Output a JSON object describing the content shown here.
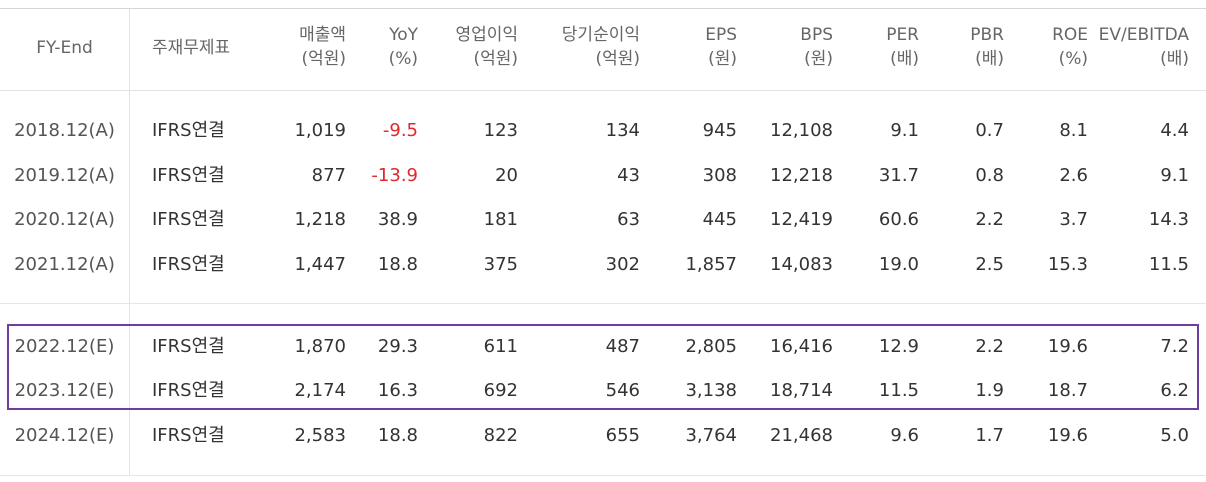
{
  "table": {
    "headers": [
      {
        "key": "fy",
        "line1": "FY-End",
        "line2": ""
      },
      {
        "key": "type",
        "line1": "주재무제표",
        "line2": ""
      },
      {
        "key": "sales",
        "line1": "매출액",
        "line2": "(억원)"
      },
      {
        "key": "yoy",
        "line1": "YoY",
        "line2": "(%)"
      },
      {
        "key": "op",
        "line1": "영업이익",
        "line2": "(억원)"
      },
      {
        "key": "net",
        "line1": "당기순이익",
        "line2": "(억원)"
      },
      {
        "key": "eps",
        "line1": "EPS",
        "line2": "(원)"
      },
      {
        "key": "bps",
        "line1": "BPS",
        "line2": "(원)"
      },
      {
        "key": "per",
        "line1": "PER",
        "line2": "(배)"
      },
      {
        "key": "pbr",
        "line1": "PBR",
        "line2": "(배)"
      },
      {
        "key": "roe",
        "line1": "ROE",
        "line2": "(%)"
      },
      {
        "key": "ev",
        "line1": "EV/EBITDA",
        "line2": "(배)"
      }
    ],
    "rows": [
      {
        "fy": "2018.12(A)",
        "type": "IFRS연결",
        "sales": "1,019",
        "yoy": "-9.5",
        "op": "123",
        "net": "134",
        "eps": "945",
        "bps": "12,108",
        "per": "9.1",
        "pbr": "0.7",
        "roe": "8.1",
        "ev": "4.4"
      },
      {
        "fy": "2019.12(A)",
        "type": "IFRS연결",
        "sales": "877",
        "yoy": "-13.9",
        "op": "20",
        "net": "43",
        "eps": "308",
        "bps": "12,218",
        "per": "31.7",
        "pbr": "0.8",
        "roe": "2.6",
        "ev": "9.1"
      },
      {
        "fy": "2020.12(A)",
        "type": "IFRS연결",
        "sales": "1,218",
        "yoy": "38.9",
        "op": "181",
        "net": "63",
        "eps": "445",
        "bps": "12,419",
        "per": "60.6",
        "pbr": "2.2",
        "roe": "3.7",
        "ev": "14.3"
      },
      {
        "fy": "2021.12(A)",
        "type": "IFRS연결",
        "sales": "1,447",
        "yoy": "18.8",
        "op": "375",
        "net": "302",
        "eps": "1,857",
        "bps": "14,083",
        "per": "19.0",
        "pbr": "2.5",
        "roe": "15.3",
        "ev": "11.5"
      },
      {
        "fy": "2022.12(E)",
        "type": "IFRS연결",
        "sales": "1,870",
        "yoy": "29.3",
        "op": "611",
        "net": "487",
        "eps": "2,805",
        "bps": "16,416",
        "per": "12.9",
        "pbr": "2.2",
        "roe": "19.6",
        "ev": "7.2"
      },
      {
        "fy": "2023.12(E)",
        "type": "IFRS연결",
        "sales": "2,174",
        "yoy": "16.3",
        "op": "692",
        "net": "546",
        "eps": "3,138",
        "bps": "18,714",
        "per": "11.5",
        "pbr": "1.9",
        "roe": "18.7",
        "ev": "6.2"
      },
      {
        "fy": "2024.12(E)",
        "type": "IFRS연결",
        "sales": "2,583",
        "yoy": "18.8",
        "op": "822",
        "net": "655",
        "eps": "3,764",
        "bps": "21,468",
        "per": "9.6",
        "pbr": "1.7",
        "roe": "19.6",
        "ev": "5.0"
      }
    ],
    "highlighted_rows": [
      "2022.12(E)",
      "2023.12(E)"
    ],
    "colors": {
      "negative": "#e0282d",
      "highlight_border": "#6a3fa0"
    }
  }
}
